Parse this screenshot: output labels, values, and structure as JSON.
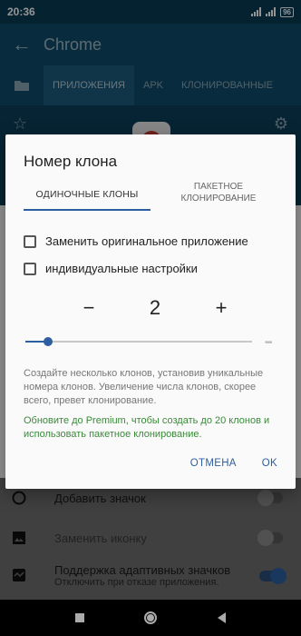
{
  "status_bar": {
    "time": "20:36",
    "battery": "96"
  },
  "app_bar": {
    "title": "Chrome"
  },
  "tabs": [
    "ПРИЛОЖЕНИЯ",
    "APK",
    "КЛОНИРОВАННЫЕ"
  ],
  "dialog": {
    "title": "Номер клона",
    "tab_single": "ОДИНОЧНЫЕ КЛОНЫ",
    "tab_batch_line1": "ПАКЕТНОЕ",
    "tab_batch_line2": "КЛОНИРОВАНИЕ",
    "checkbox_replace": "Заменить оригинальное приложение",
    "checkbox_individual": "индивидуальные настройки",
    "stepper_minus": "−",
    "stepper_value": "2",
    "stepper_plus": "+",
    "help_text": "Создайте несколько клонов, установив уникальные номера клонов. Увеличение числа клонов, скорее всего, превет клонирование.",
    "promo_text": "Обновите до Premium, чтобы создать до 20 клонов и использовать пакетное клонирование.",
    "cancel_label": "ОТМЕНА",
    "ok_label": "OK"
  },
  "settings": {
    "add_icon_label": "Добавить значок",
    "replace_icon_label": "Заменить иконку",
    "adaptive_label": "Поддержка адаптивных значков",
    "adaptive_sub": "Отключить при отказе приложения."
  },
  "colors": {
    "primary": "#0f4c6b",
    "accent": "#2d5fa0",
    "promo": "#3a8a3a"
  }
}
